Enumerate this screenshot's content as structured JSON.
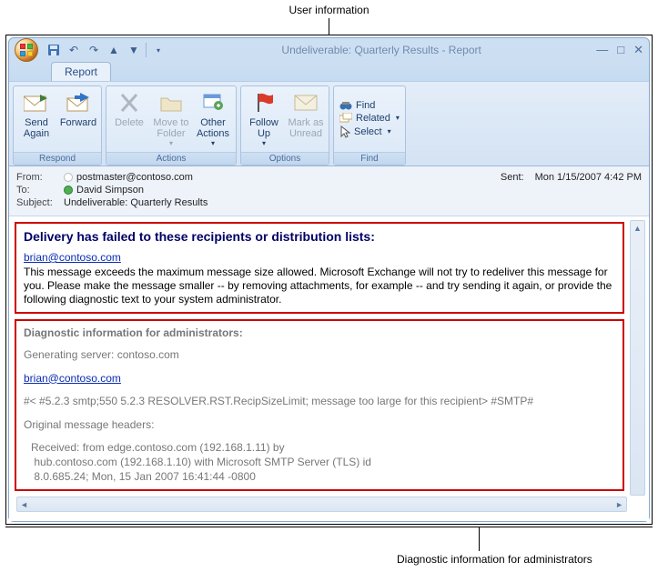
{
  "annotations": {
    "top": "User information",
    "bottom": "Diagnostic information for administrators"
  },
  "window": {
    "title": "Undeliverable: Quarterly Results - Report"
  },
  "tab": {
    "report": "Report"
  },
  "ribbon": {
    "respond": {
      "label": "Respond",
      "send_again": "Send\nAgain",
      "forward": "Forward"
    },
    "actions": {
      "label": "Actions",
      "delete": "Delete",
      "move_to_folder": "Move to\nFolder",
      "other_actions": "Other\nActions"
    },
    "options": {
      "label": "Options",
      "follow_up": "Follow\nUp",
      "mark_unread": "Mark as\nUnread"
    },
    "find": {
      "label": "Find",
      "find_btn": "Find",
      "related": "Related",
      "select": "Select"
    }
  },
  "headers": {
    "from_label": "From:",
    "from_value": "postmaster@contoso.com",
    "to_label": "To:",
    "to_value": "David Simpson",
    "subject_label": "Subject:",
    "subject_value": "Undeliverable: Quarterly Results",
    "sent_label": "Sent:",
    "sent_value": "Mon 1/15/2007 4:42 PM"
  },
  "user_info": {
    "heading": "Delivery has failed to these recipients or distribution lists:",
    "recipient": "brian@contoso.com",
    "body": "This message exceeds the maximum message size allowed. Microsoft Exchange will not try to redeliver this message for you. Please make the message smaller -- by removing attachments, for example -- and try sending it again, or provide the following diagnostic text to your system administrator."
  },
  "diag": {
    "heading": "Diagnostic information for administrators:",
    "gen_server": "Generating server: contoso.com",
    "recipient": "brian@contoso.com",
    "code": "#< #5.2.3 smtp;550 5.2.3 RESOLVER.RST.RecipSizeLimit; message too large for this recipient> #SMTP#",
    "orig_headers_label": "Original message headers:",
    "received1": "Received: from edge.contoso.com (192.168.1.11) by",
    "received2": "hub.contoso.com (192.168.1.10) with Microsoft SMTP Server (TLS) id",
    "received3": "8.0.685.24; Mon, 15 Jan 2007 16:41:44 -0800"
  }
}
